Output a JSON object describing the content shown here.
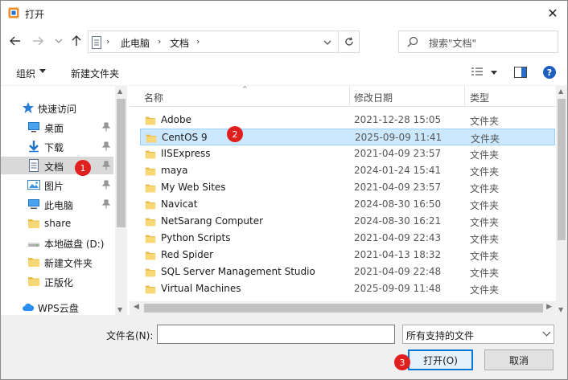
{
  "window": {
    "title": "打开",
    "close_glyph": "✕"
  },
  "nav": {
    "back": "back-arrow-icon",
    "breadcrumb": [
      "此电脑",
      "文档"
    ],
    "search_placeholder": "搜索\"文档\""
  },
  "toolbar": {
    "organize": "组织",
    "new_folder": "新建文件夹"
  },
  "sidebar": {
    "items": [
      {
        "label": "快速访问",
        "icon": "star-icon",
        "pinned": false
      },
      {
        "label": "桌面",
        "icon": "desktop-icon",
        "pinned": true
      },
      {
        "label": "下载",
        "icon": "download-icon",
        "pinned": true
      },
      {
        "label": "文档",
        "icon": "document-icon",
        "pinned": true,
        "selected": true
      },
      {
        "label": "图片",
        "icon": "picture-icon",
        "pinned": true
      },
      {
        "label": "此电脑",
        "icon": "computer-icon",
        "pinned": true
      },
      {
        "label": "share",
        "icon": "folder-icon",
        "pinned": false
      },
      {
        "label": "本地磁盘 (D:)",
        "icon": "drive-icon",
        "pinned": false
      },
      {
        "label": "新建文件夹",
        "icon": "folder-icon",
        "pinned": false
      },
      {
        "label": "正版化",
        "icon": "folder-icon",
        "pinned": false
      },
      {
        "label": "WPS云盘",
        "icon": "cloud-icon",
        "pinned": false
      }
    ]
  },
  "columns": {
    "name": "名称",
    "date": "修改日期",
    "type": "类型"
  },
  "files": [
    {
      "name": "Adobe",
      "date": "2021-12-28 15:05",
      "type": "文件夹"
    },
    {
      "name": "CentOS 9",
      "date": "2025-09-09 11:41",
      "type": "文件夹",
      "selected": true
    },
    {
      "name": "IISExpress",
      "date": "2021-04-09 23:57",
      "type": "文件夹"
    },
    {
      "name": "maya",
      "date": "2024-01-24 15:41",
      "type": "文件夹"
    },
    {
      "name": "My Web Sites",
      "date": "2021-04-09 23:57",
      "type": "文件夹"
    },
    {
      "name": "Navicat",
      "date": "2024-08-30 16:50",
      "type": "文件夹"
    },
    {
      "name": "NetSarang Computer",
      "date": "2024-08-30 16:21",
      "type": "文件夹"
    },
    {
      "name": "Python Scripts",
      "date": "2021-04-09 22:43",
      "type": "文件夹"
    },
    {
      "name": "Red Spider",
      "date": "2021-04-13 18:32",
      "type": "文件夹"
    },
    {
      "name": "SQL Server Management Studio",
      "date": "2021-04-09 22:48",
      "type": "文件夹"
    },
    {
      "name": "Virtual Machines",
      "date": "2025-09-09 11:48",
      "type": "文件夹"
    }
  ],
  "bottom": {
    "filename_label": "文件名(N):",
    "filename_value": "",
    "filter_value": "所有支持的文件",
    "open_button": "打开(O)",
    "cancel_button": "取消"
  },
  "badges": [
    "1",
    "2",
    "3"
  ],
  "colors": {
    "accent": "#0078d7",
    "selection": "#cce8ff",
    "folder": "#f8d775",
    "badge": "#e0201f"
  }
}
